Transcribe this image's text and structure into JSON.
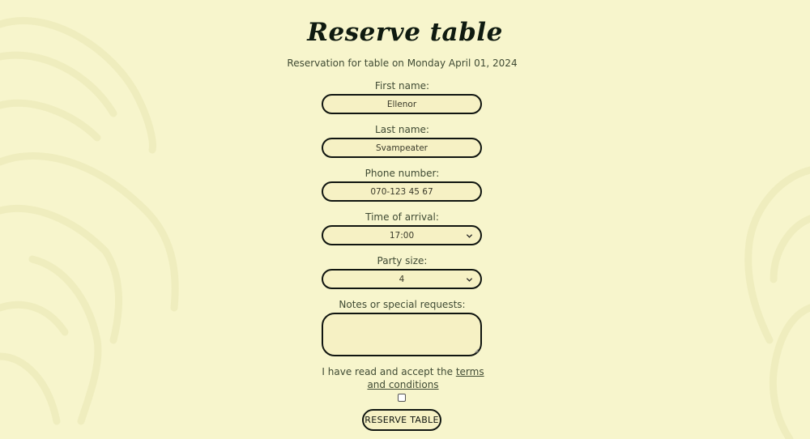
{
  "page": {
    "title": "Reserve table",
    "subtitle": "Reservation for table on Monday April 01, 2024"
  },
  "form": {
    "first_name": {
      "label": "First name:",
      "value": "Ellenor"
    },
    "last_name": {
      "label": "Last name:",
      "value": "Svampeater"
    },
    "phone": {
      "label": "Phone number:",
      "value": "070-123 45 67"
    },
    "arrival": {
      "label": "Time of arrival:",
      "value": "17:00"
    },
    "party": {
      "label": "Party size:",
      "value": "4"
    },
    "notes": {
      "label": "Notes or special requests:",
      "value": ""
    },
    "terms": {
      "text_before": "I have read and accept the ",
      "link": "terms and conditions",
      "checked": false
    },
    "submit_label": "RESERVE TABLE"
  },
  "colors": {
    "background": "#f7f5cc",
    "field_bg": "#f6f1c4",
    "border": "#101510",
    "text": "#3f4a33"
  }
}
